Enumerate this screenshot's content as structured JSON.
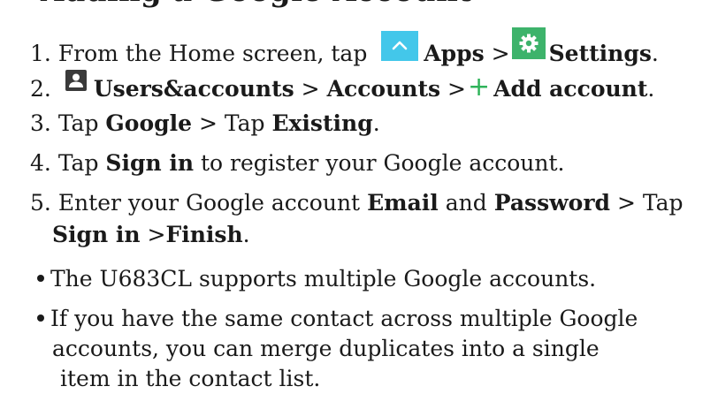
{
  "heading": "Adding a Google Account",
  "steps": {
    "s1": {
      "num": "1.",
      "pre": "From the Home screen, tap",
      "apps": "Apps",
      "sep": ">",
      "settings": "Settings",
      "end": "."
    },
    "s2": {
      "num": "2.",
      "users": "Users&accounts",
      "sep1": ">",
      "accounts": "Accounts",
      "sep2": ">",
      "plus": "+",
      "add": "Add account",
      "end": "."
    },
    "s3": {
      "num": "3.",
      "pre": "Tap",
      "google": "Google",
      "mid": "> Tap",
      "existing": "Existing",
      "end": "."
    },
    "s4": {
      "num": "4.",
      "pre": "Tap",
      "signin": "Sign in",
      "post": "to register your Google account."
    },
    "s5": {
      "num": "5.",
      "pre": "Enter your Google account",
      "email": "Email",
      "and": "and",
      "password": "Password",
      "tap": "> Tap",
      "signin": "Sign in",
      "sep": ">",
      "finish": "Finish",
      "end": "."
    }
  },
  "bullets": {
    "b1": "The U683CL supports multiple Google accounts.",
    "b2_l1": "If you have the same contact across multiple Google",
    "b2_l2": "accounts, you can merge duplicates into a single",
    "b2_l3": "item in the contact list."
  },
  "icons": {
    "apps": "chevron-up-icon",
    "settings": "gear-icon",
    "users": "person-icon"
  },
  "colors": {
    "apps_bg": "#43c7ea",
    "settings_bg": "#3db36b",
    "plus": "#2fb35a"
  }
}
